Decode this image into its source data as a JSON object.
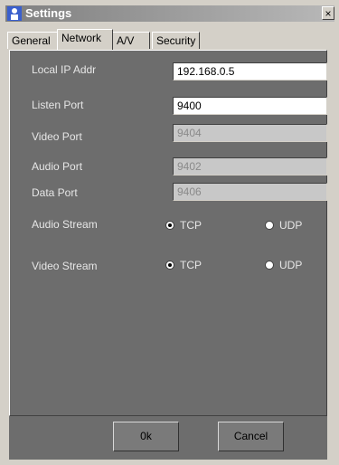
{
  "window": {
    "title": "Settings",
    "close_symbol": "×",
    "icon": "person-settings-icon"
  },
  "tabs": [
    {
      "label": "General",
      "active": false
    },
    {
      "label": "Network",
      "active": true
    },
    {
      "label": "A/V",
      "active": false
    },
    {
      "label": "Security",
      "active": false
    }
  ],
  "network": {
    "local_ip": {
      "label": "Local IP Addr",
      "value": "192.168.0.5"
    },
    "listen_port": {
      "label": "Listen Port",
      "value": "9400"
    },
    "video_port": {
      "label": "Video Port",
      "value": "9404"
    },
    "audio_port": {
      "label": "Audio Port",
      "value": "9402"
    },
    "data_port": {
      "label": "Data Port",
      "value": "9406"
    },
    "audio_stream": {
      "label": "Audio Stream",
      "tcp": "TCP",
      "udp": "UDP",
      "selected": "TCP"
    },
    "video_stream": {
      "label": "Video Stream",
      "tcp": "TCP",
      "udp": "UDP",
      "selected": "TCP"
    }
  },
  "buttons": {
    "ok": "0k",
    "cancel": "Cancel"
  }
}
